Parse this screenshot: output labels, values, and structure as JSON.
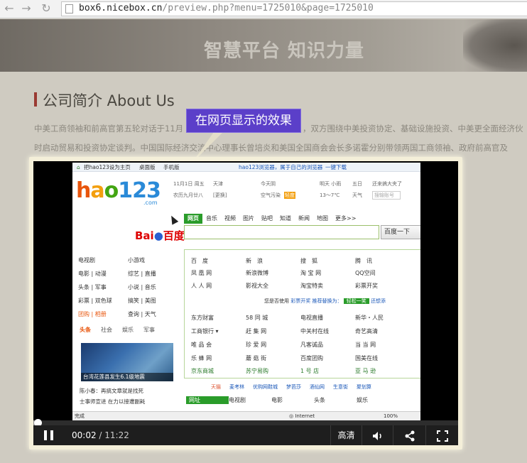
{
  "browser": {
    "back_icon": "arrow-left-icon",
    "forward_icon": "arrow-right-icon",
    "reload_icon": "reload-icon",
    "url_host": "box6.nicebox.cn",
    "url_path": "/preview.php?menu=1725010&page=1725010"
  },
  "banner": {
    "title": "智慧平台 知识力量"
  },
  "section": {
    "title": "公司简介 About Us",
    "line1": "中美工商领袖和前高官第五轮对话于11月",
    "line1b": "，双方围绕中美投资协定、基础设施投资、中美更全面经济伙",
    "line2": "时启动贸易和投资协定谈判。中国国际经济交流中心理事长曾培炎和美国全国商会会长多诺霍分别带领两国工商领袖、政府前高官及"
  },
  "callout": {
    "text": "在网页显示的效果"
  },
  "video": {
    "current_time": "00:02",
    "separator": " / ",
    "total_time": "11:22",
    "progress": 0.005,
    "quality_label": "高清",
    "volume_icon": "volume-icon",
    "share_icon": "share-icon",
    "fullscreen_icon": "fullscreen-icon",
    "pause_icon": "pause-icon"
  },
  "inner_page": {
    "topbar": {
      "set_home": "把hao123设为主页",
      "desktop": "桌面版",
      "mobile": "手机版",
      "browser": "hao123浏览器，属于自己的浏览器",
      "download": "一键下载"
    },
    "logo": {
      "h": "h",
      "a": "a",
      "o": "o",
      "n": "123",
      "com": ".com"
    },
    "weather": {
      "date": "11月1日 周五",
      "lunar": "农历九月廿八",
      "city": "天津",
      "change": "[更换]",
      "today": "今天阴",
      "air": "空气污染",
      "air_level": "轻度",
      "tomorrow": "明天 小雨",
      "temp": "13～7℃",
      "fri": "五日",
      "weather": "天气",
      "reminder": "还来搞大夹了",
      "search_ph": "搜输账号"
    },
    "baidu": {
      "bai": "Bai",
      "du": "du",
      "cn": "百度"
    },
    "search_tabs": [
      "网页",
      "音乐",
      "视频",
      "图片",
      "贴吧",
      "知道",
      "新闻",
      "地图",
      "更多>>"
    ],
    "search_btn": "百度一下",
    "left_rows": [
      [
        "电视剧",
        "小游戏"
      ],
      [
        "电影 | 动漫",
        "综艺 | 直播"
      ],
      [
        "头条 | 军事",
        "小说 | 音乐"
      ],
      [
        "彩票 | 双色球",
        "搞笑 | 美图"
      ],
      [
        "团购 | 相册",
        "查询 | 天气"
      ]
    ],
    "left_tabs": [
      "头条",
      "社会",
      "娱乐",
      "军事"
    ],
    "news_caption": "台湾花莲县发生6.1级地震",
    "left_news": [
      "陈小春：再搞文章就是找死",
      "士事师宣进 在力以接遭副耗"
    ],
    "sites_row1": [
      "百　度",
      "新　浪",
      "搜　狐",
      "腾　讯"
    ],
    "sites_row2": [
      "凤 凰 网",
      "新浪微博",
      "淘 宝 网",
      "QQ空间"
    ],
    "sites_row3": [
      "人 人 网",
      "影视大全",
      "淘宝特卖",
      "彩票开奖"
    ],
    "tip": {
      "a": "您是否使用",
      "b": "彩票开奖",
      "c": "推荐替换为：",
      "d": "轻松一笑",
      "e": "还想添"
    },
    "sites_row4": [
      "东方财富",
      "58 同 城",
      "电视直播",
      "新华・人民"
    ],
    "sites_row5": [
      "工商银行 ▾",
      "赶 集 网",
      "中关村在线",
      "奇艺高清"
    ],
    "sites_row6": [
      "唯 品 会",
      "珍 爱 网",
      "凡客诚品",
      "当 当 网"
    ],
    "sites_row7": [
      "乐 蜂 网",
      "蘑 菇 街",
      "百度团购",
      "国美在线"
    ],
    "sites_row8": [
      "京东商城",
      "苏宁易购",
      "1 号 店",
      "亚 马 逊"
    ],
    "cat_strip": [
      "天猫",
      "麦考林",
      "优购网鞋城",
      "梦芭莎",
      "酒仙网",
      "生意街",
      "聚划算"
    ],
    "bottom_tabs": [
      "网址",
      "电视剧",
      "电影",
      "头条",
      "娱乐"
    ],
    "status": {
      "done": "完成",
      "zone": "Internet",
      "zoom": "100%"
    }
  }
}
